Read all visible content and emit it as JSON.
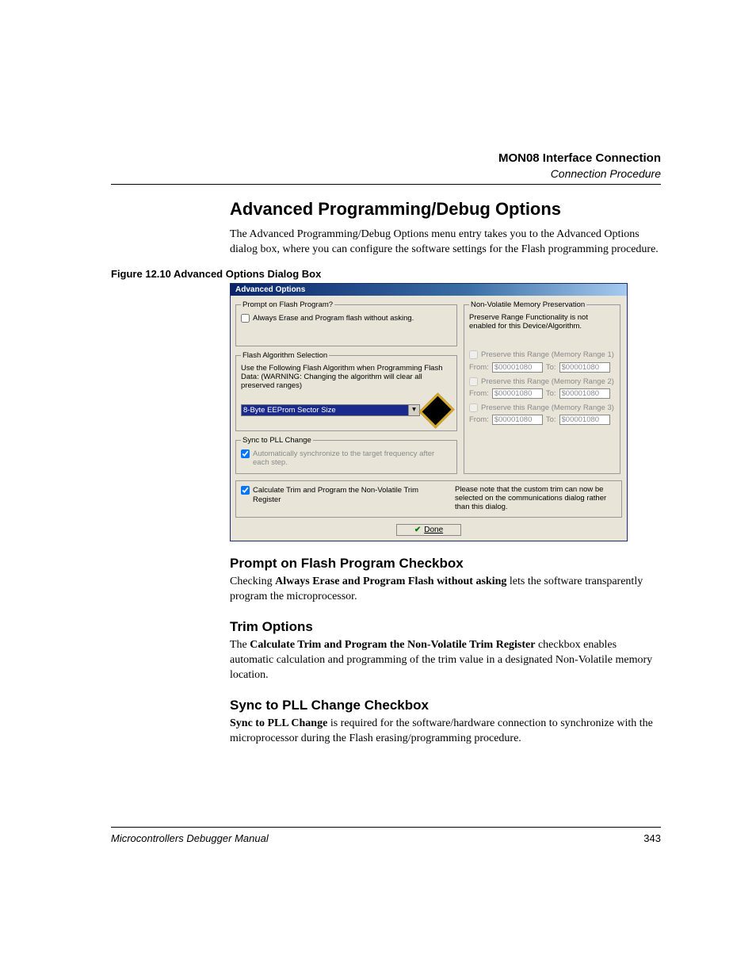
{
  "header": {
    "title": "MON08 Interface Connection",
    "subtitle": "Connection Procedure"
  },
  "section": {
    "title": "Advanced Programming/Debug Options",
    "intro": "The Advanced Programming/Debug Options menu entry takes you to the Advanced Options dialog box, where you can configure the software settings for the Flash programming procedure."
  },
  "figure": {
    "caption": "Figure 12.10  Advanced Options Dialog Box"
  },
  "dialog": {
    "title": "Advanced Options",
    "prompt_group": {
      "legend": "Prompt on Flash Program?",
      "checkbox_label": "Always Erase and Program flash without asking.",
      "checked": false
    },
    "algo_group": {
      "legend": "Flash Algorithm Selection",
      "desc": "Use the Following Flash Algorithm when Programming Flash Data: (WARNING: Changing the algorithm will clear all preserved ranges)",
      "selected": "8-Byte EEProm Sector Size"
    },
    "sync_group": {
      "legend": "Sync to PLL Change",
      "checkbox_label": "Automatically synchronize to the target frequency after each step.",
      "checked": true
    },
    "nvmp_group": {
      "legend": "Non-Volatile Memory Preservation",
      "desc": "Preserve Range Functionality is not enabled for this Device/Algorithm.",
      "ranges": [
        {
          "label": "Preserve this Range (Memory Range 1)",
          "from_lbl": "From:",
          "from": "$00001080",
          "to_lbl": "To:",
          "to": "$00001080"
        },
        {
          "label": "Preserve this Range (Memory Range 2)",
          "from_lbl": "From:",
          "from": "$00001080",
          "to_lbl": "To:",
          "to": "$00001080"
        },
        {
          "label": "Preserve this Range (Memory Range 3)",
          "from_lbl": "From:",
          "from": "$00001080",
          "to_lbl": "To:",
          "to": "$00001080"
        }
      ]
    },
    "trim_row": {
      "checkbox_label": "Calculate Trim and Program the Non-Volatile Trim Register",
      "checked": true,
      "note": "Please note that the custom trim can now be selected on the communications dialog rather than this dialog."
    },
    "done_label": "Done"
  },
  "sub1": {
    "title": "Prompt on Flash Program Checkbox",
    "text_before": "Checking ",
    "bold": "Always Erase and Program Flash without asking",
    "text_after": " lets the software transparently program the microprocessor."
  },
  "sub2": {
    "title": "Trim Options",
    "text_before": "The ",
    "bold": "Calculate Trim and Program the Non-Volatile Trim Register",
    "text_after": " checkbox enables automatic calculation and programming of the trim value in a designated Non-Volatile memory location."
  },
  "sub3": {
    "title": "Sync to PLL Change Checkbox",
    "bold": "Sync to PLL Change",
    "text_after": " is required for the software/hardware connection to synchronize with the microprocessor during the Flash erasing/programming procedure."
  },
  "footer": {
    "manual": "Microcontrollers Debugger Manual",
    "page": "343"
  }
}
